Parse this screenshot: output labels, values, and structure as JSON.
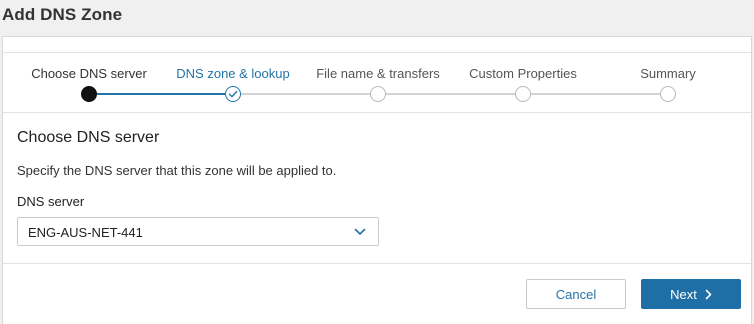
{
  "window": {
    "title": "Add DNS Zone"
  },
  "wizard": {
    "steps": [
      {
        "label": "Choose DNS server",
        "state": "done"
      },
      {
        "label": "DNS zone & lookup",
        "state": "current"
      },
      {
        "label": "File name & transfers",
        "state": "pending"
      },
      {
        "label": "Custom Properties",
        "state": "pending"
      },
      {
        "label": "Summary",
        "state": "pending"
      }
    ]
  },
  "main": {
    "section_title": "Choose DNS server",
    "description": "Specify the DNS server that this zone will be applied to.",
    "dns_server": {
      "label": "DNS server",
      "value": "ENG-AUS-NET-441"
    }
  },
  "footer": {
    "cancel_label": "Cancel",
    "next_label": "Next"
  },
  "colors": {
    "accent": "#2474a6",
    "primary_button": "#1d6fa5",
    "done_node": "#111111",
    "pending_node": "#b8b8b8"
  },
  "icons": {
    "current_step": "check-icon",
    "select": "chevron-down-icon",
    "next": "chevron-right-icon"
  }
}
